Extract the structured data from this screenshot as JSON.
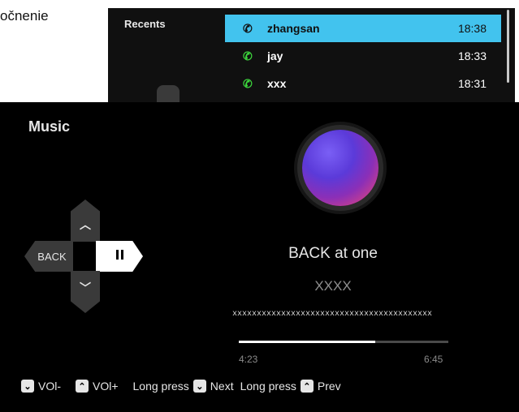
{
  "document": {
    "fragment_text": "očnenie"
  },
  "recents": {
    "title": "Recents",
    "items": [
      {
        "name": "zhangsan",
        "time": "18:38",
        "selected": true
      },
      {
        "name": "jay",
        "time": "18:33",
        "selected": false
      },
      {
        "name": "xxx",
        "time": "18:31",
        "selected": false
      }
    ]
  },
  "music": {
    "title": "Music",
    "song_title": "BACK at one",
    "artist": "XXXX",
    "lyrics": "xxxxxxxxxxxxxxxxxxxxxxxxxxxxxxxxxxxxxxxxx",
    "elapsed": "4:23",
    "total": "6:45",
    "progress_fraction": 0.65,
    "controls": {
      "up": "^",
      "down": "v",
      "back": "BACK"
    }
  },
  "footer": {
    "vol_down": "VOl-",
    "vol_up": "VOl+",
    "next_prefix": "Long press",
    "next": "Next",
    "prev_prefix": "Long press",
    "prev": "Prev"
  },
  "colors": {
    "accent": "#42c3ee",
    "call_icon": "#3cd43c"
  }
}
